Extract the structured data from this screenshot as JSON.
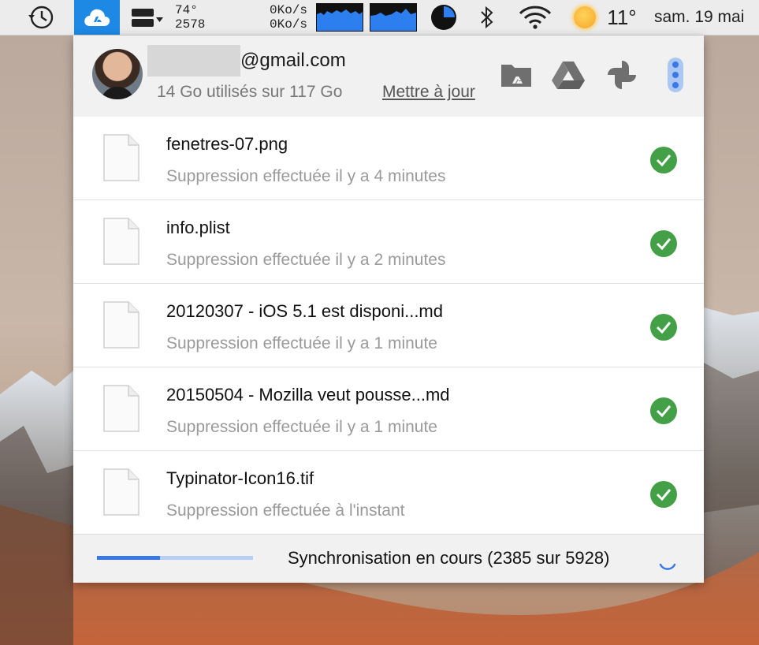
{
  "menubar": {
    "cpu_temp": "74°",
    "fan_speed": "2578",
    "net_up": "0Ko/s",
    "net_down": "0Ko/s",
    "weather_temp": "11°",
    "clock": "sam. 19 mai",
    "icons": [
      "time-machine-icon",
      "google-drive-cloud-icon",
      "memory-icon",
      "network-graph-icon",
      "cpu-graph-icon",
      "pie-icon",
      "bluetooth-icon",
      "wifi-icon",
      "sun-icon"
    ],
    "accent": "#1e88e5"
  },
  "account": {
    "email_domain": "@gmail.com",
    "quota": "14 Go utilisés sur 117 Go",
    "upgrade": "Mettre à jour"
  },
  "header_icons": [
    "folder-drive-icon",
    "google-drive-icon",
    "google-photos-icon",
    "more-vertical-icon"
  ],
  "files": [
    {
      "name": "fenetres-07.png",
      "status": "Suppression effectuée il y a 4 minutes"
    },
    {
      "name": "info.plist",
      "status": "Suppression effectuée il y a 2 minutes"
    },
    {
      "name": "20120307 - iOS 5.1 est disponi...md",
      "status": "Suppression effectuée il y a 1 minute"
    },
    {
      "name": "20150504 - Mozilla veut pousse...md",
      "status": "Suppression effectuée il y a 1 minute"
    },
    {
      "name": "Typinator-Icon16.tif",
      "status": "Suppression effectuée à l'instant"
    }
  ],
  "sync": {
    "text": "Synchronisation en cours (2385 sur 5928)",
    "done": 2385,
    "total": 5928
  },
  "colors": {
    "check": "#43a047",
    "progress": "#3b78e7",
    "progress_track": "#b7cff5"
  }
}
